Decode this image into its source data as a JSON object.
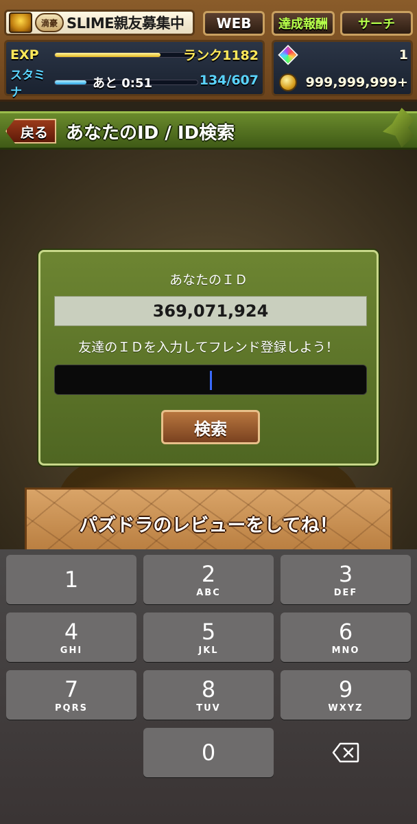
{
  "status": {
    "rank_badge": "滴豪",
    "player_title": "SLIME親友募集中",
    "buttons": {
      "web": "WEB",
      "reward": "達成報酬",
      "search": "サーチ"
    },
    "exp": {
      "label": "EXP",
      "rank": "ランク1182",
      "progress": 0.74
    },
    "stamina": {
      "label": "スタミナ",
      "timer": "あと 0:51",
      "value": "134/607",
      "progress": 0.22
    },
    "stones": "1",
    "coins": "999,999,999+"
  },
  "header": {
    "back_label": "戻る",
    "title": "あなたのID / ID検索"
  },
  "dialog": {
    "your_id_label": "あなたのＩＤ",
    "your_id": "369,071,924",
    "prompt": "友達のＩＤを入力してフレンド登録しよう！",
    "input_value": "",
    "search_label": "検索"
  },
  "banner": {
    "text": "パズドラのレビューをしてね！"
  },
  "keypad": {
    "keys": [
      {
        "digit": "1",
        "letters": ""
      },
      {
        "digit": "2",
        "letters": "ABC"
      },
      {
        "digit": "3",
        "letters": "DEF"
      },
      {
        "digit": "4",
        "letters": "GHI"
      },
      {
        "digit": "5",
        "letters": "JKL"
      },
      {
        "digit": "6",
        "letters": "MNO"
      },
      {
        "digit": "7",
        "letters": "PQRS"
      },
      {
        "digit": "8",
        "letters": "TUV"
      },
      {
        "digit": "9",
        "letters": "WXYZ"
      },
      {
        "digit": "0",
        "letters": ""
      }
    ]
  },
  "colors": {
    "header_green": "#5a7a22",
    "dialog_green": "#607a2c",
    "exp_yellow": "#ffe95a",
    "stamina_blue": "#5ad4ff",
    "search_button": "#9a5c2e",
    "key_gray": "#6e6c6c"
  },
  "icons": [
    "leader-monster-icon",
    "magic-stone-icon",
    "coin-icon",
    "delete-backspace-icon",
    "dragon-wing-ornament-icon"
  ]
}
